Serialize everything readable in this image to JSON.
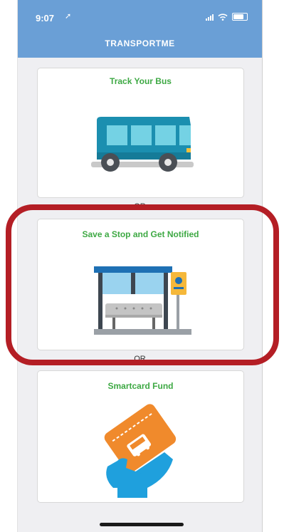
{
  "status_bar": {
    "time": "9:07",
    "location_arrow": "➚"
  },
  "header": {
    "title": "TRANSPORTME",
    "color": "#6a9fd6"
  },
  "cards": [
    {
      "title": "Track Your Bus",
      "icon": "bus-icon"
    },
    {
      "title": "Save a Stop and Get Notified",
      "icon": "bus-stop-icon"
    },
    {
      "title": "Smartcard Fund",
      "icon": "smartcard-icon"
    }
  ],
  "separator": "OR",
  "accent_color": "#3ea944",
  "highlight_color": "#b41e25"
}
